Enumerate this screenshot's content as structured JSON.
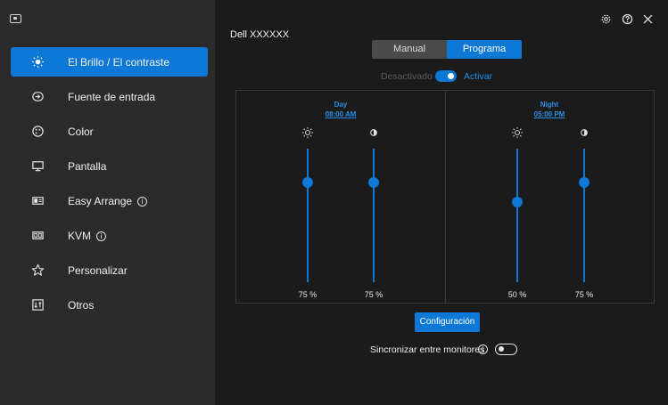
{
  "sidebar": {
    "items": [
      {
        "label": "El Brillo / El contraste",
        "icon": "brightness-icon",
        "active": true
      },
      {
        "label": "Fuente de entrada",
        "icon": "input-source-icon"
      },
      {
        "label": "Color",
        "icon": "color-icon"
      },
      {
        "label": "Pantalla",
        "icon": "display-icon"
      },
      {
        "label": "Easy Arrange",
        "icon": "easy-arrange-icon",
        "info": true
      },
      {
        "label": "KVM",
        "icon": "kvm-icon",
        "info": true
      },
      {
        "label": "Personalizar",
        "icon": "star-icon"
      },
      {
        "label": "Otros",
        "icon": "others-icon"
      }
    ],
    "info_glyph": "i"
  },
  "header": {
    "monitor_name": "Dell XXXXXX"
  },
  "mode_tabs": {
    "manual": "Manual",
    "schedule": "Programa",
    "selected": "schedule"
  },
  "schedule_toggle": {
    "off_label": "Desactivado",
    "on_label": "Activar",
    "state": "on"
  },
  "schedule": {
    "day": {
      "title": "Day",
      "time": "08:00 AM",
      "brightness": "75 %",
      "contrast": "75 %",
      "brightness_level": 0.75,
      "contrast_level": 0.75
    },
    "night": {
      "title": "Night",
      "time": "05:00 PM",
      "brightness": "50 %",
      "contrast": "75 %",
      "brightness_level": 0.5,
      "contrast_level": 0.75
    }
  },
  "actions": {
    "config_label": "Configuración",
    "sync_label": "Sincronizar entre monitores",
    "sync_info": "i",
    "sync_state": "off"
  },
  "colors": {
    "accent": "#0d78d6",
    "sidebar_bg": "#2b2b2b",
    "main_bg": "#1b1b1b"
  }
}
